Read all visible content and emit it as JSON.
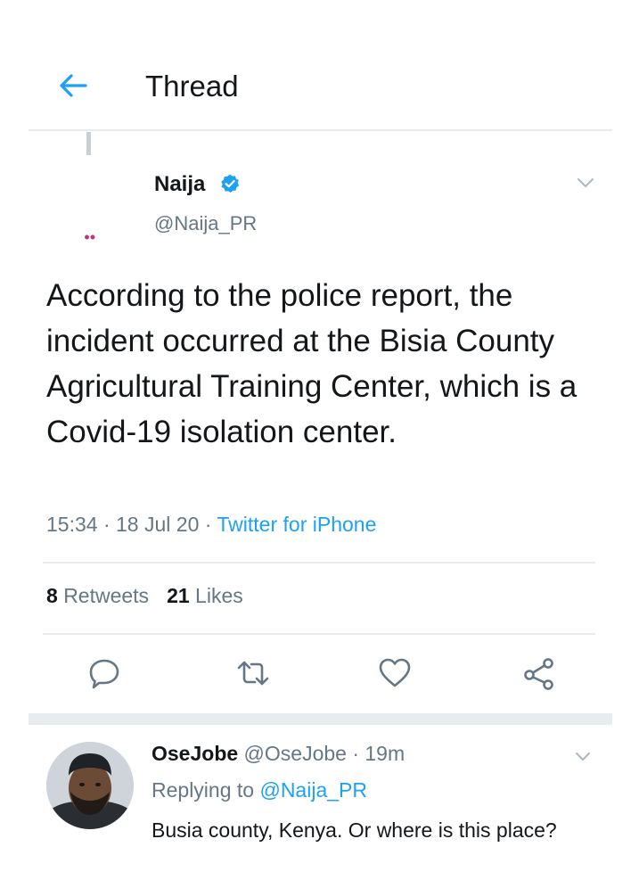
{
  "header": {
    "title": "Thread"
  },
  "tweet": {
    "author_name": "Naija",
    "author_handle": "@Naija_PR",
    "text": "According to the police report, the incident occurred at the Bisia County Agricultural Training Center, which is a Covid-19 isolation center.",
    "time": "15:34",
    "sep1": " · ",
    "date": "18 Jul 20",
    "sep2": " · ",
    "source": "Twitter for iPhone",
    "retweets_count": "8",
    "retweets_label": "Retweets",
    "likes_count": "21",
    "likes_label": "Likes"
  },
  "reply": {
    "name": "OseJobe",
    "handle_time": " @OseJobe · 19m",
    "replying_prefix": "Replying to ",
    "replying_handle": "@Naija_PR",
    "text": "Busia county, Kenya. Or where is this place?"
  },
  "colors": {
    "accent": "#1da1f2",
    "text_primary": "#14171a",
    "text_secondary": "#657786",
    "divider": "#e6ecf0"
  },
  "icons": {
    "back": "arrow-left-icon",
    "verified": "verified-badge-icon",
    "chevron": "chevron-down-icon",
    "reply": "speech-bubble-icon",
    "retweet": "retweet-icon",
    "like": "heart-icon",
    "share": "share-icon"
  }
}
